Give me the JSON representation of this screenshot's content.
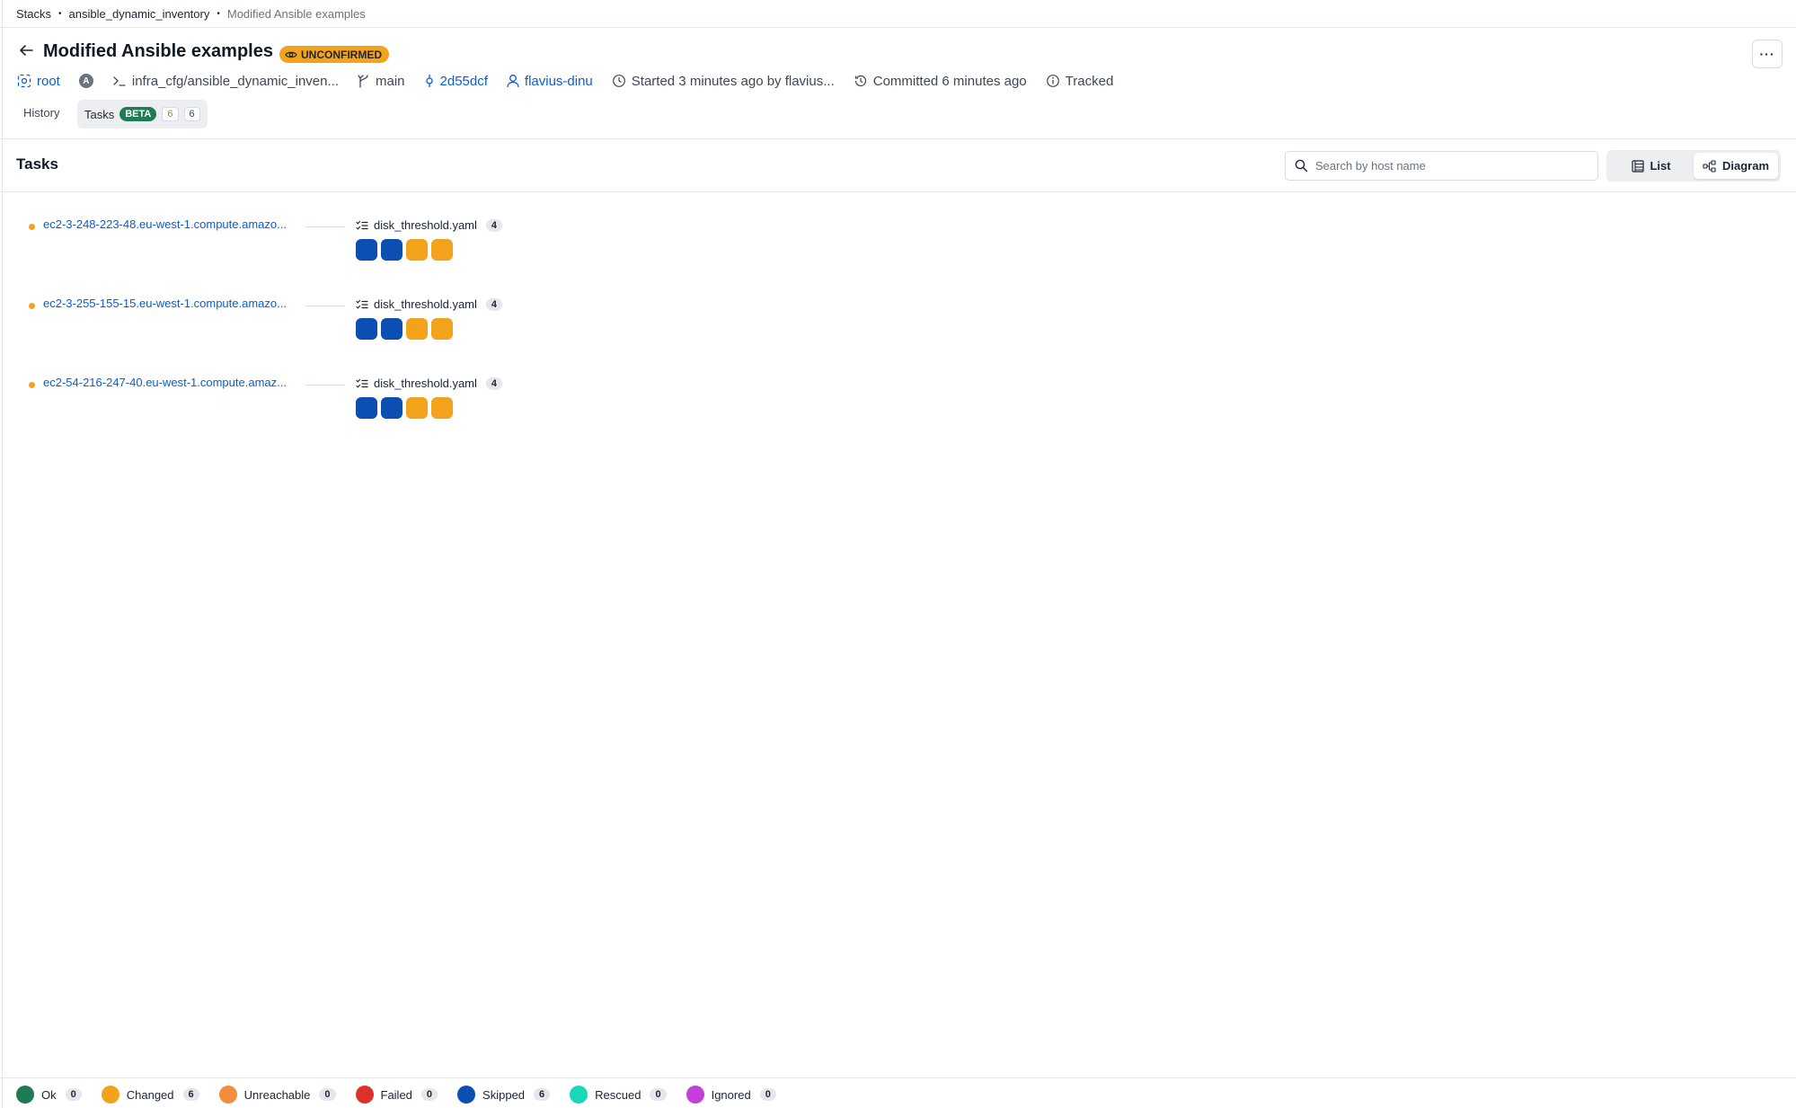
{
  "breadcrumb": {
    "items": [
      "Stacks",
      "ansible_dynamic_inventory",
      "Modified Ansible examples"
    ]
  },
  "header": {
    "title": "Modified Ansible examples",
    "status": "UNCONFIRMED",
    "more_label": "···"
  },
  "meta": {
    "space": "root",
    "avatar_letter": "A",
    "path": "infra_cfg/ansible_dynamic_inven...",
    "branch": "main",
    "commit": "2d55dcf",
    "author": "flavius-dinu",
    "started": "Started 3 minutes ago by flavius...",
    "committed": "Committed 6 minutes ago",
    "tracked": "Tracked"
  },
  "tabs": {
    "history": "History",
    "tasks": "Tasks",
    "beta": "BETA",
    "changed_count": "6",
    "skipped_count": "6"
  },
  "tasks_section": {
    "title": "Tasks",
    "search_placeholder": "Search by host name",
    "view_list": "List",
    "view_diagram": "Diagram"
  },
  "hosts": [
    {
      "name": "ec2-3-248-223-48.eu-west-1.compute.amazo...",
      "playbook": "disk_threshold.yaml",
      "task_count": "4",
      "tasks": [
        "skipped",
        "skipped",
        "changed",
        "changed"
      ]
    },
    {
      "name": "ec2-3-255-155-15.eu-west-1.compute.amazo...",
      "playbook": "disk_threshold.yaml",
      "task_count": "4",
      "tasks": [
        "skipped",
        "skipped",
        "changed",
        "changed"
      ]
    },
    {
      "name": "ec2-54-216-247-40.eu-west-1.compute.amaz...",
      "playbook": "disk_threshold.yaml",
      "task_count": "4",
      "tasks": [
        "skipped",
        "skipped",
        "changed",
        "changed"
      ]
    }
  ],
  "colors": {
    "ok": "#1f7a55",
    "changed": "#f2a31b",
    "unreachable": "#f28c3f",
    "failed": "#e0302b",
    "skipped": "#0b4fb3",
    "rescued": "#1ad7b8",
    "ignored": "#c43fd9"
  },
  "legend": [
    {
      "key": "ok",
      "label": "Ok",
      "count": "0"
    },
    {
      "key": "changed",
      "label": "Changed",
      "count": "6"
    },
    {
      "key": "unreachable",
      "label": "Unreachable",
      "count": "0"
    },
    {
      "key": "failed",
      "label": "Failed",
      "count": "0"
    },
    {
      "key": "skipped",
      "label": "Skipped",
      "count": "6"
    },
    {
      "key": "rescued",
      "label": "Rescued",
      "count": "0"
    },
    {
      "key": "ignored",
      "label": "Ignored",
      "count": "0"
    }
  ]
}
